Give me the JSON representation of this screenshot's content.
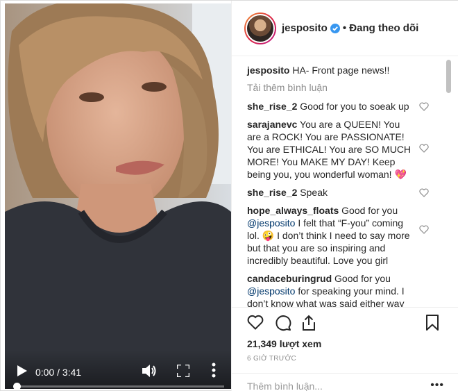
{
  "video": {
    "time_display": "0:00 / 3:41",
    "progress": 0
  },
  "post": {
    "username": "jesposito",
    "follow_status": "• Đang theo dõi",
    "caption_user": "jesposito",
    "caption_text": "HA- Front page news!!",
    "load_more": "Tải thêm bình luận",
    "comments": [
      {
        "user": "she_rise_2",
        "text": "Good for you to soeak up"
      },
      {
        "user": "sarajanevc",
        "text": "You are a QUEEN! You are a ROCK! You are PASSIONATE! You are ETHICAL! You are SO MUCH MORE! You MAKE MY DAY! Keep being you, you wonderful woman! 💖"
      },
      {
        "user": "she_rise_2",
        "text": "Speak"
      },
      {
        "user": "hope_always_floats",
        "text": "Good for you",
        "mention": "@jesposito",
        "text2": "I felt that “F-you” coming lol. 🤪  I don’t think I need to say more but that you are so inspiring and incredibly beautiful. Love you girl"
      },
      {
        "user": "candaceburingrud",
        "text": "Good for you",
        "mention": "@jesposito",
        "text2": "for speaking your mind. I don’t know what was said either way but I don’t need to because I am too"
      }
    ],
    "views": "21,349 lượt xem",
    "time_ago": "6 GIỜ TRƯỚC",
    "add_comment_placeholder": "Thêm bình luận...",
    "more_label": "•••"
  },
  "colors": {
    "accent": "#0095f6",
    "verified": "#3897f0",
    "muted": "#8e8e8e"
  },
  "icons": [
    "play-icon",
    "volume-icon",
    "fullscreen-icon",
    "more-vertical-icon",
    "verified-icon",
    "heart-icon",
    "comment-icon",
    "share-icon",
    "bookmark-icon"
  ]
}
